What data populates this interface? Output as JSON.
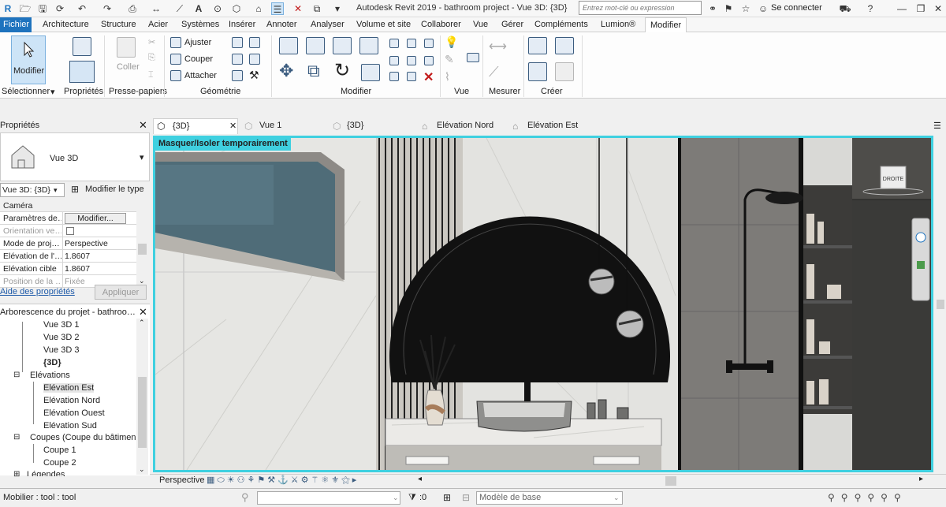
{
  "titlebar": {
    "app_title": "Autodesk Revit 2019 - bathroom project - Vue 3D: {3D}",
    "search_placeholder": "Entrez mot-clé ou expression",
    "signin": "Se connecter"
  },
  "menu": {
    "tabs": [
      "Fichier",
      "Architecture",
      "Structure",
      "Acier",
      "Systèmes",
      "Insérer",
      "Annoter",
      "Analyser",
      "Volume et site",
      "Collaborer",
      "Vue",
      "Gérer",
      "Compléments",
      "Lumion®",
      "Modifier"
    ]
  },
  "ribbon": {
    "modify": "Modifier",
    "coller": "Coller",
    "ajuster": "Ajuster",
    "couper": "Couper",
    "attacher": "Attacher",
    "panels": {
      "selectionner": "Sélectionner",
      "proprietes": "Propriétés",
      "presse_papiers": "Presse-papiers",
      "geometrie": "Géométrie",
      "modifier": "Modifier",
      "vue": "Vue",
      "mesurer": "Mesurer",
      "creer": "Créer"
    }
  },
  "properties": {
    "title": "Propriétés",
    "type_name": "Vue 3D",
    "view_selector": "Vue 3D: {3D}",
    "edit_type": "Modifier le type",
    "category": "Caméra",
    "rows": [
      {
        "k": "Paramètres de…",
        "v": "Modifier..."
      },
      {
        "k": "Orientation ve…",
        "v": ""
      },
      {
        "k": "Mode de proj…",
        "v": "Perspective"
      },
      {
        "k": "Elévation de l'…",
        "v": "1.8607"
      },
      {
        "k": "Elévation cible",
        "v": "1.8607"
      },
      {
        "k": "Position de la …",
        "v": "Fixée"
      }
    ],
    "help": "Aide des propriétés",
    "apply": "Appliquer"
  },
  "browser": {
    "title": "Arborescence du projet - bathroo…",
    "items": [
      "Vue 3D 1",
      "Vue 3D 2",
      "Vue 3D 3",
      "{3D}",
      "Elévations",
      "Elévation Est",
      "Elévation Nord",
      "Elévation Ouest",
      "Elévation Sud",
      "Coupes (Coupe du bâtiment)",
      "Coupe 1",
      "Coupe 2",
      "Légendes"
    ]
  },
  "viewtabs": [
    "{3D}",
    "Vue 1",
    "{3D}",
    "Elévation Nord",
    "Elévation Est"
  ],
  "viewport": {
    "banner": "Masquer/Isoler temporairement",
    "viewcube": "DROITE"
  },
  "viewbar": {
    "mode": "Perspective"
  },
  "status": {
    "message": "Mobilier : tool : tool",
    "selection_count": ":0",
    "model": "Modèle de base"
  },
  "colors": {
    "accent": "#1e73be",
    "isolate": "#3fd0e0"
  }
}
